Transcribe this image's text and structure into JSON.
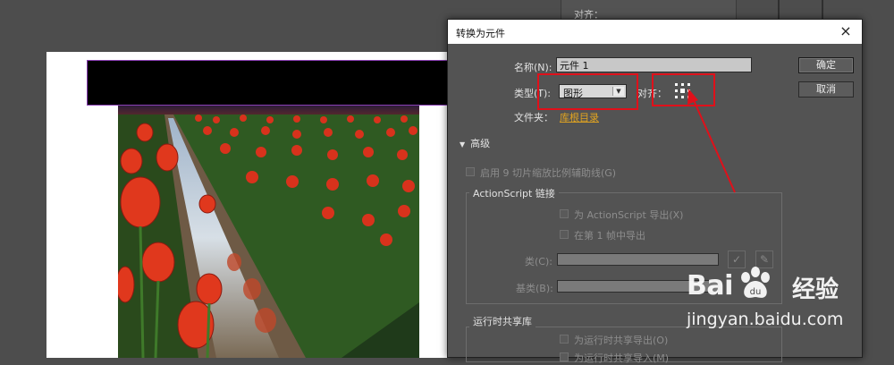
{
  "background": {
    "panel_label": "对齐：",
    "photo_description": "tulip field"
  },
  "dialog": {
    "title": "转换为元件",
    "close_glyph": "×",
    "name_label": "名称(N):",
    "name_value": "元件 1",
    "type_label": "类型(T):",
    "type_value": "图形",
    "align_label": "对齐：",
    "folder_label": "文件夹：",
    "folder_link": "库根目录",
    "ok_label": "确定",
    "cancel_label": "取消",
    "advanced_label": "高级",
    "scale9_label": "启用 9 切片缩放比例辅助线(G)",
    "actionscript_group": "ActionScript 链接",
    "export_as_label": "为 ActionScript 导出(X)",
    "export_frame_label": "在第 1 帧中导出",
    "class_label": "类(C):",
    "base_class_label": "基类(B):",
    "runtime_group": "运行时共享库",
    "runtime_export_label": "为运行时共享导出(O)",
    "runtime_import_label": "为运行时共享导入(M)",
    "check_icon": "check-icon",
    "pencil_icon": "pencil-icon"
  },
  "annotation": {
    "color": "#e0101a"
  },
  "watermark": {
    "brand_left": "Bai",
    "brand_right": "经验",
    "url": "jingyan.baidu.com"
  }
}
